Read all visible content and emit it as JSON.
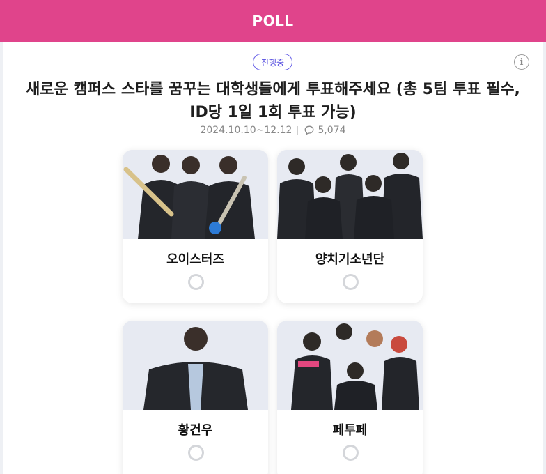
{
  "header": {
    "title": "POLL"
  },
  "poll": {
    "status": "진행중",
    "info_icon": "info-icon",
    "title_line1": "새로운 캠퍼스 스타를 꿈꾸는 대학생들에게 투표해주세요 (총 5팀 투표 필수,",
    "title_line2": "ID당 1일 1회 투표 가능)",
    "period": "2024.10.10~12.12",
    "comment_icon": "comment-icon",
    "comment_count": "5,074"
  },
  "candidates": [
    {
      "name": "오이스터즈"
    },
    {
      "name": "양치기소년단"
    },
    {
      "name": "황건우"
    },
    {
      "name": "페투페"
    }
  ],
  "colors": {
    "brand": "#e0448b",
    "badge": "#5a52e0"
  }
}
